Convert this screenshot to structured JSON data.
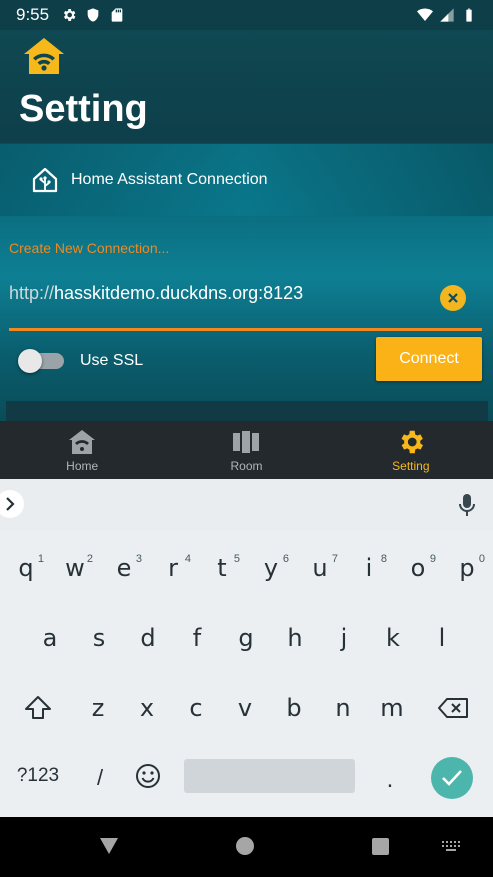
{
  "status_bar": {
    "time": "9:55",
    "icons": [
      "gear-icon",
      "shield-icon",
      "sd-card-icon",
      "wifi-icon",
      "signal-icon",
      "battery-icon"
    ]
  },
  "header": {
    "title": "Setting",
    "logo_icon": "home-wifi-icon",
    "accent_color": "#f7b81c"
  },
  "connection_card": {
    "label": "Home Assistant Connection",
    "icon": "home-assistant-icon"
  },
  "form": {
    "field_label": "Create New Connection...",
    "url_prefix": "http://",
    "url_value": "hasskitdemo.duckdns.org:8123",
    "ssl_label": "Use SSL",
    "ssl_enabled": false,
    "connect_label": "Connect",
    "label_color": "#f0891f",
    "button_color": "#fbb216"
  },
  "bottom_nav": {
    "items": [
      {
        "label": "Home",
        "icon": "home-icon",
        "active": false
      },
      {
        "label": "Room",
        "icon": "room-icon",
        "active": false
      },
      {
        "label": "Setting",
        "icon": "gear-icon",
        "active": true
      }
    ]
  },
  "keyboard": {
    "row1": [
      {
        "k": "q",
        "h": "1"
      },
      {
        "k": "w",
        "h": "2"
      },
      {
        "k": "e",
        "h": "3"
      },
      {
        "k": "r",
        "h": "4"
      },
      {
        "k": "t",
        "h": "5"
      },
      {
        "k": "y",
        "h": "6"
      },
      {
        "k": "u",
        "h": "7"
      },
      {
        "k": "i",
        "h": "8"
      },
      {
        "k": "o",
        "h": "9"
      },
      {
        "k": "p",
        "h": "0"
      }
    ],
    "row2": [
      "a",
      "s",
      "d",
      "f",
      "g",
      "h",
      "j",
      "k",
      "l"
    ],
    "row3": [
      "z",
      "x",
      "c",
      "v",
      "b",
      "n",
      "m"
    ],
    "symbols_label": "?123",
    "slash": "/",
    "period": "."
  }
}
